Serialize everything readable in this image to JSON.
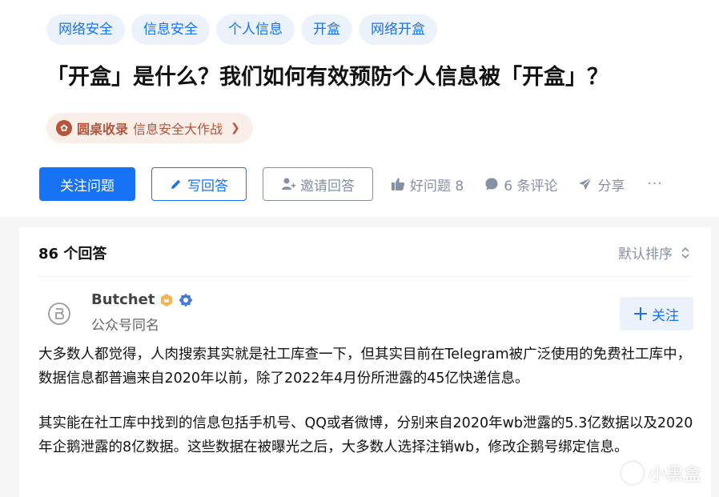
{
  "question": {
    "tags": [
      "网络安全",
      "信息安全",
      "个人信息",
      "开盒",
      "网络开盒"
    ],
    "title": "「开盒」是什么？我们如何有效预防个人信息被「开盒」？",
    "roundtable": {
      "name": "圆桌收录",
      "subtitle": "信息安全大作战",
      "arrow": "❯"
    }
  },
  "actions": {
    "follow_label": "关注问题",
    "write_label": "写回答",
    "invite_label": "邀请回答",
    "good_label": "好问题 8",
    "comment_label": "6 条评论",
    "share_label": "分享",
    "more_label": "···"
  },
  "answers": {
    "count_label": "86 个回答",
    "sort_label": "默认排序",
    "first": {
      "author_name": "Butchet",
      "author_bio": "公众号同名",
      "follow_label": "关注",
      "paragraphs": [
        "大多数人都觉得，人肉搜索其实就是社工库查一下，但其实目前在Telegram被广泛使用的免费社工库中，数据信息都普遍来自2020年以前，除了2022年4月份所泄露的45亿快递信息。",
        "其实能在社工库中找到的信息包括手机号、QQ或者微博，分别来自2020年wb泄露的5.3亿数据以及2020年企鹅泄露的8亿数据。这些数据在被曝光之后，大多数人选择注销wb，修改企鹅号绑定信息。"
      ]
    }
  },
  "watermark": {
    "text": "小黑盒"
  },
  "icons": {
    "roundtable": "roundtable-icon",
    "write": "pencil-icon",
    "invite": "add-user-icon",
    "good": "thumbs-up-icon",
    "comment": "comment-bubble-icon",
    "share": "paper-plane-icon",
    "sort": "sort-chevrons-icon",
    "badge_level": "level-badge-icon",
    "badge_verified": "verified-badge-icon",
    "plus": "plus-icon"
  },
  "colors": {
    "brand": "#1772f6",
    "muted": "#8590a6",
    "roundtable": "#b6553a"
  }
}
